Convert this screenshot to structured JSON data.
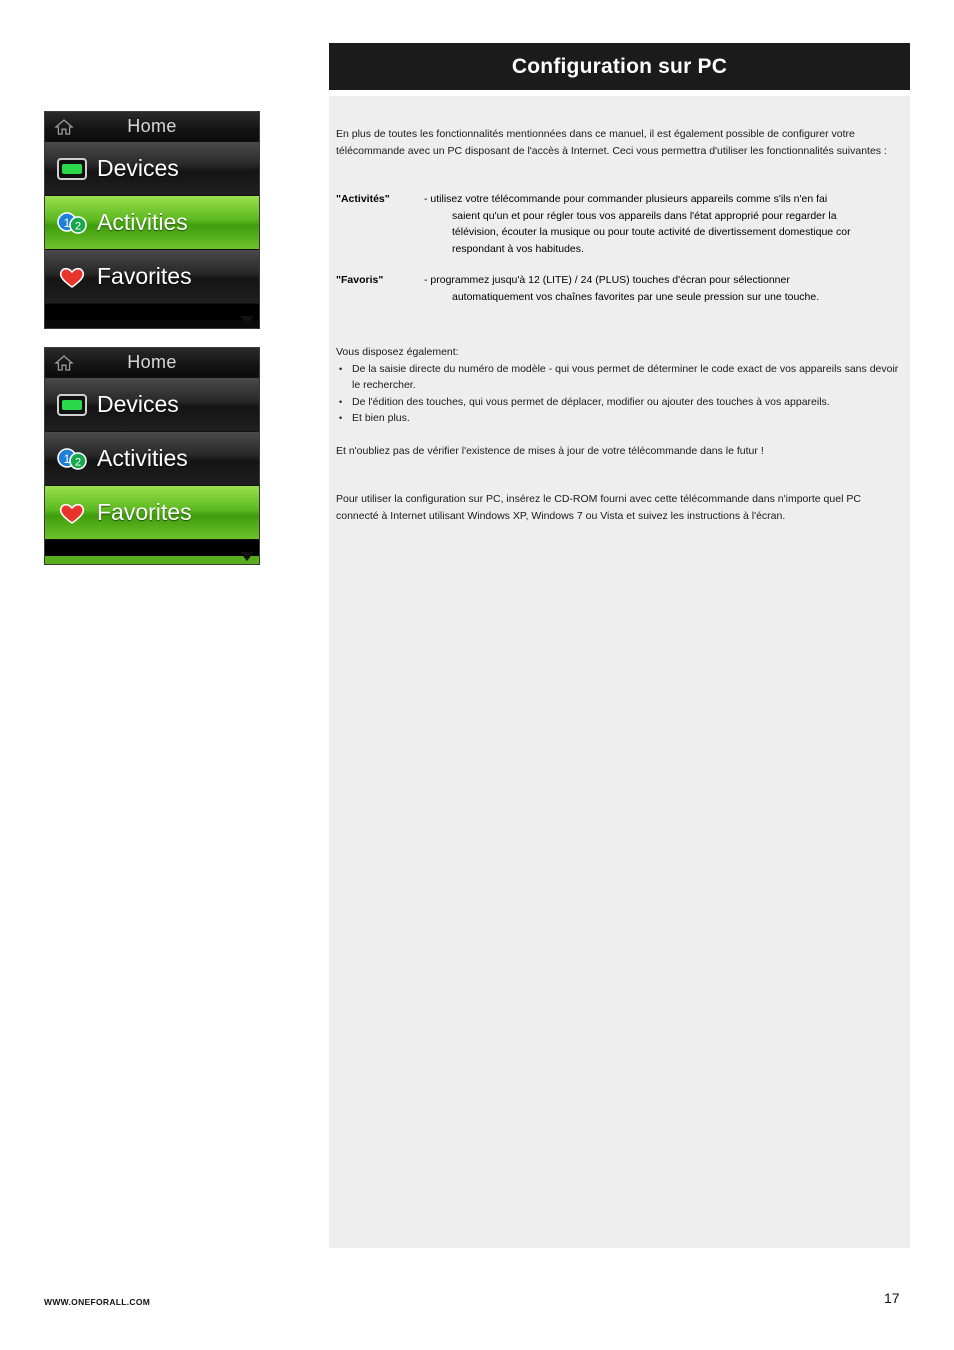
{
  "header": {
    "title": "Configuration sur PC"
  },
  "content": {
    "intro": "En plus de toutes les fonctionnalités mentionnées dans ce manuel, il est également possible de configurer votre télécommande avec un PC disposant de l'accès à Internet. Ceci vous permettra d'utiliser les fonctionnalités suivantes :",
    "definitions": [
      {
        "term": "\"Activités\"",
        "line1": "- utilisez votre télécommande pour commander plusieurs appareils comme s'ils n'en fai",
        "line2": "saient qu'un et pour régler tous vos appareils dans l'état approprié pour regarder la",
        "line3": "télévision, écouter la musique ou pour toute activité de divertissement domestique cor",
        "line4": "respondant à vos habitudes."
      },
      {
        "term": "\"Favoris\"",
        "line1": "- programmez jusqu'à 12 (LITE) / 24 (PLUS) touches d'écran pour sélectionner",
        "line2": "automatiquement vos  chaînes favorites par une seule pression sur une touche.",
        "line3": "",
        "line4": ""
      }
    ],
    "also_intro": "Vous disposez également:",
    "bullets": [
      "De la saisie directe du numéro de modèle - qui vous permet de déterminer le code exact de vos appareils sans devoir le rechercher.",
      "De l'édition des touches, qui vous permet de déplacer, modifier ou ajouter des touches à vos appareils.",
      "Et bien plus."
    ],
    "reminder": "Et n'oubliez pas de vérifier l'existence de mises à jour de votre télécommande dans le futur !",
    "closing": "Pour utiliser la configuration sur PC, insérez le CD-ROM fourni avec cette télécommande dans n'importe quel PC connecté à Internet utilisant Windows XP, Windows 7 ou Vista et suivez les instructions à l'écran."
  },
  "screens": [
    {
      "name": "screen-activities-selected",
      "home_label": "Home",
      "rows": [
        {
          "label": "Devices",
          "icon": "device-screen-icon",
          "state": "dark"
        },
        {
          "label": "Activities",
          "icon": "activities-icon",
          "state": "selected"
        },
        {
          "label": "Favorites",
          "icon": "heart-icon",
          "state": "dark"
        }
      ]
    },
    {
      "name": "screen-favorites-selected",
      "home_label": "Home",
      "rows": [
        {
          "label": "Devices",
          "icon": "device-screen-icon",
          "state": "dark"
        },
        {
          "label": "Activities",
          "icon": "activities-icon",
          "state": "dark"
        },
        {
          "label": "Favorites",
          "icon": "heart-icon",
          "state": "selected"
        }
      ]
    }
  ],
  "footer": {
    "url": "WWW.ONEFORALL.COM",
    "page": "17"
  },
  "colors": {
    "header_bg": "#1b1b1b",
    "panel_bg": "#eeeeee",
    "accent_green": "#5cb81f"
  }
}
